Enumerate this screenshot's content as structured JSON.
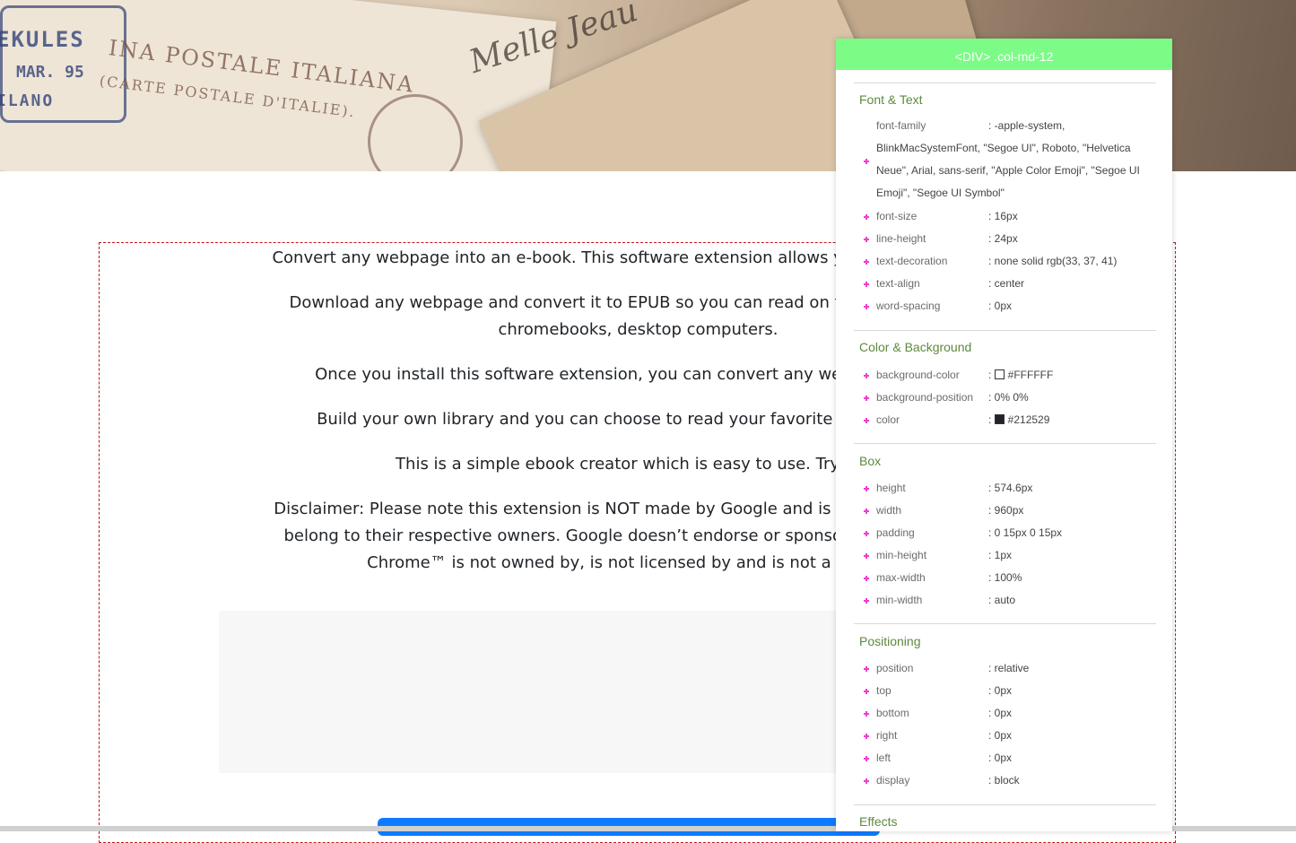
{
  "hero": {
    "stamp_lines": [
      "EKULES",
      "MAR. 95",
      "ILANO"
    ],
    "postale_text": "INA POSTALE ITALIANA",
    "postale_sub": "(CARTE POSTALE D'ITALIE).",
    "script_text": "Melle Jeau"
  },
  "content": {
    "paragraphs": [
      "Convert any webpage into an e-book. This software extension allows you to convert any w",
      "Download any webpage and convert it to EPUB so you can read on the following devic",
      "chromebooks, desktop computers.",
      "Once you install this software extension, you can convert any webpage to EPUB",
      "Build your own library and you can choose to read your favorite articles/blogs c",
      "This is a simple ebook creator which is easy to use. Try it ou",
      "Disclaimer: Please note this extension is NOT made by Google and is made by an indepen",
      "belong to their respective owners. Google doesn’t endorse or sponsor this Chrome exte",
      "Chrome™ is not owned by, is not licensed by and is not a subsidiar"
    ]
  },
  "inspector": {
    "header": "<DIV> .col-md-12",
    "sections": {
      "font_text": {
        "title": "Font & Text",
        "font_family_name": "font-family",
        "font_family_value_1": ": -apple-system,",
        "font_family_value_2": "BlinkMacSystemFont, \"Segoe UI\", Roboto, \"Helvetica",
        "font_family_value_3": "Neue\", Arial, sans-serif, \"Apple Color Emoji\", \"Segoe UI",
        "font_family_value_4": "Emoji\", \"Segoe UI Symbol\"",
        "props": [
          {
            "name": "font-size",
            "value": ": 16px"
          },
          {
            "name": "line-height",
            "value": ": 24px"
          },
          {
            "name": "text-decoration",
            "value": ": none solid rgb(33, 37, 41)"
          },
          {
            "name": "text-align",
            "value": ": center"
          },
          {
            "name": "word-spacing",
            "value": ": 0px"
          }
        ]
      },
      "color_bg": {
        "title": "Color & Background",
        "props": [
          {
            "name": "background-color",
            "value": "#FFFFFF",
            "swatch": "#FFFFFF"
          },
          {
            "name": "background-position",
            "value": ": 0% 0%"
          },
          {
            "name": "color",
            "value": "#212529",
            "swatch": "#212529"
          }
        ]
      },
      "box": {
        "title": "Box",
        "props": [
          {
            "name": "height",
            "value": ": 574.6px"
          },
          {
            "name": "width",
            "value": ": 960px"
          },
          {
            "name": "padding",
            "value": ": 0 15px 0 15px"
          },
          {
            "name": "min-height",
            "value": ": 1px"
          },
          {
            "name": "max-width",
            "value": ": 100%"
          },
          {
            "name": "min-width",
            "value": ": auto"
          }
        ]
      },
      "positioning": {
        "title": "Positioning",
        "props": [
          {
            "name": "position",
            "value": ": relative"
          },
          {
            "name": "top",
            "value": ": 0px"
          },
          {
            "name": "bottom",
            "value": ": 0px"
          },
          {
            "name": "right",
            "value": ": 0px"
          },
          {
            "name": "left",
            "value": ": 0px"
          },
          {
            "name": "display",
            "value": ": block"
          }
        ]
      },
      "effects": {
        "title": "Effects"
      }
    }
  },
  "colors": {
    "header_green": "#7cfc86",
    "section_title": "#5d8a3c",
    "bullet": "#ee3fd0",
    "container_border": "#c4161c",
    "button_blue": "#0d7bff"
  }
}
